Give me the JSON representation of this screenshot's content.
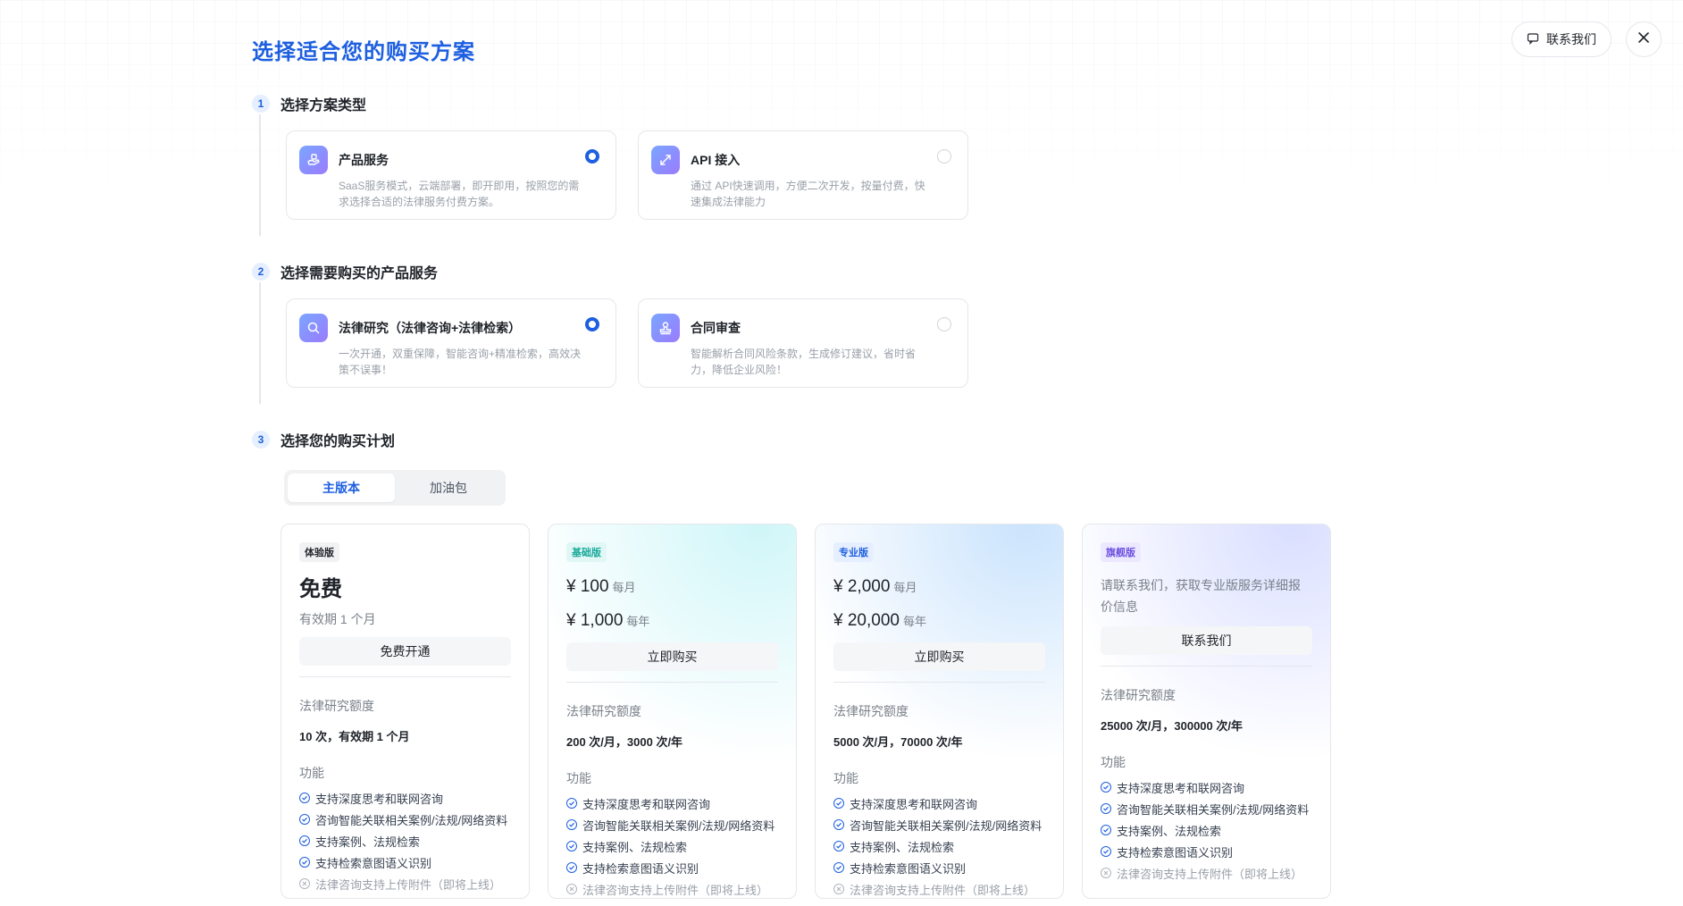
{
  "header": {
    "title": "选择适合您的购买方案",
    "contact_label": "联系我们"
  },
  "steps": [
    {
      "num": "1",
      "title": "选择方案类型",
      "options": [
        {
          "title": "产品服务",
          "desc": "SaaS服务模式，云端部署，即开即用，按照您的需求选择合适的法律服务付费方案。",
          "selected": true
        },
        {
          "title": "API 接入",
          "desc": "通过 API快速调用，方便二次开发，按量付费，快速集成法律能力",
          "selected": false
        }
      ]
    },
    {
      "num": "2",
      "title": "选择需要购买的产品服务",
      "options": [
        {
          "title": "法律研究（法律咨询+法律检索）",
          "desc": "一次开通，双重保障，智能咨询+精准检索，高效决策不误事！",
          "selected": true
        },
        {
          "title": "合同审查",
          "desc": "智能解析合同风险条款，生成修订建议，省时省力，降低企业风险！",
          "selected": false
        }
      ]
    },
    {
      "num": "3",
      "title": "选择您的购买计划"
    }
  ],
  "plan_tabs": [
    {
      "label": "主版本",
      "active": true
    },
    {
      "label": "加油包",
      "active": false
    }
  ],
  "plans": [
    {
      "badge": "体验版",
      "price_big": "免费",
      "validity": "有效期 1 个月",
      "button": "免费开通",
      "quota_label": "法律研究额度",
      "quota": "10 次，有效期 1 个月",
      "features_label": "功能"
    },
    {
      "badge": "基础版",
      "monthly": "¥ 100",
      "monthly_unit": "每月",
      "yearly": "¥ 1,000",
      "yearly_unit": "每年",
      "button": "立即购买",
      "quota_label": "法律研究额度",
      "quota": "200 次/月，3000 次/年",
      "features_label": "功能"
    },
    {
      "badge": "专业版",
      "monthly": "¥ 2,000",
      "monthly_unit": "每月",
      "yearly": "¥ 20,000",
      "yearly_unit": "每年",
      "button": "立即购买",
      "quota_label": "法律研究额度",
      "quota": "5000 次/月，70000 次/年",
      "features_label": "功能"
    },
    {
      "badge": "旗舰版",
      "contact_note": "请联系我们，获取专业版服务详细报价信息",
      "button": "联系我们",
      "quota_label": "法律研究额度",
      "quota": "25000 次/月，300000 次/年",
      "features_label": "功能"
    }
  ],
  "features": [
    {
      "label": "支持深度思考和联网咨询",
      "enabled": true
    },
    {
      "label": "咨询智能关联相关案例/法规/网络资料",
      "enabled": true
    },
    {
      "label": "支持案例、法规检索",
      "enabled": true
    },
    {
      "label": "支持检索意图语义识别",
      "enabled": true
    },
    {
      "label": "法律咨询支持上传附件（即将上线）",
      "enabled": false
    }
  ],
  "colors": {
    "accent": "#1d5fe0",
    "muted": "#9aa0a8"
  }
}
